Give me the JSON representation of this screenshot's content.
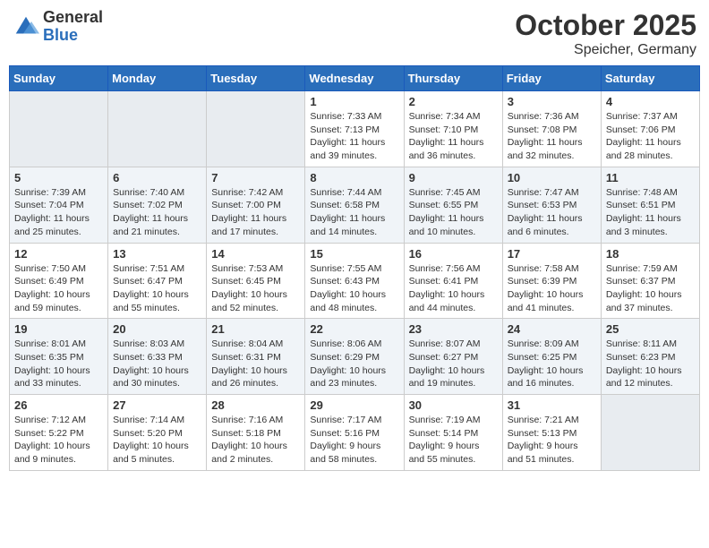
{
  "header": {
    "logo_general": "General",
    "logo_blue": "Blue",
    "month": "October 2025",
    "location": "Speicher, Germany"
  },
  "days_of_week": [
    "Sunday",
    "Monday",
    "Tuesday",
    "Wednesday",
    "Thursday",
    "Friday",
    "Saturday"
  ],
  "weeks": [
    [
      {
        "day": "",
        "info": "",
        "empty": true
      },
      {
        "day": "",
        "info": "",
        "empty": true
      },
      {
        "day": "",
        "info": "",
        "empty": true
      },
      {
        "day": "1",
        "info": "Sunrise: 7:33 AM\nSunset: 7:13 PM\nDaylight: 11 hours and 39 minutes."
      },
      {
        "day": "2",
        "info": "Sunrise: 7:34 AM\nSunset: 7:10 PM\nDaylight: 11 hours and 36 minutes."
      },
      {
        "day": "3",
        "info": "Sunrise: 7:36 AM\nSunset: 7:08 PM\nDaylight: 11 hours and 32 minutes."
      },
      {
        "day": "4",
        "info": "Sunrise: 7:37 AM\nSunset: 7:06 PM\nDaylight: 11 hours and 28 minutes."
      }
    ],
    [
      {
        "day": "5",
        "info": "Sunrise: 7:39 AM\nSunset: 7:04 PM\nDaylight: 11 hours and 25 minutes."
      },
      {
        "day": "6",
        "info": "Sunrise: 7:40 AM\nSunset: 7:02 PM\nDaylight: 11 hours and 21 minutes."
      },
      {
        "day": "7",
        "info": "Sunrise: 7:42 AM\nSunset: 7:00 PM\nDaylight: 11 hours and 17 minutes."
      },
      {
        "day": "8",
        "info": "Sunrise: 7:44 AM\nSunset: 6:58 PM\nDaylight: 11 hours and 14 minutes."
      },
      {
        "day": "9",
        "info": "Sunrise: 7:45 AM\nSunset: 6:55 PM\nDaylight: 11 hours and 10 minutes."
      },
      {
        "day": "10",
        "info": "Sunrise: 7:47 AM\nSunset: 6:53 PM\nDaylight: 11 hours and 6 minutes."
      },
      {
        "day": "11",
        "info": "Sunrise: 7:48 AM\nSunset: 6:51 PM\nDaylight: 11 hours and 3 minutes."
      }
    ],
    [
      {
        "day": "12",
        "info": "Sunrise: 7:50 AM\nSunset: 6:49 PM\nDaylight: 10 hours and 59 minutes."
      },
      {
        "day": "13",
        "info": "Sunrise: 7:51 AM\nSunset: 6:47 PM\nDaylight: 10 hours and 55 minutes."
      },
      {
        "day": "14",
        "info": "Sunrise: 7:53 AM\nSunset: 6:45 PM\nDaylight: 10 hours and 52 minutes."
      },
      {
        "day": "15",
        "info": "Sunrise: 7:55 AM\nSunset: 6:43 PM\nDaylight: 10 hours and 48 minutes."
      },
      {
        "day": "16",
        "info": "Sunrise: 7:56 AM\nSunset: 6:41 PM\nDaylight: 10 hours and 44 minutes."
      },
      {
        "day": "17",
        "info": "Sunrise: 7:58 AM\nSunset: 6:39 PM\nDaylight: 10 hours and 41 minutes."
      },
      {
        "day": "18",
        "info": "Sunrise: 7:59 AM\nSunset: 6:37 PM\nDaylight: 10 hours and 37 minutes."
      }
    ],
    [
      {
        "day": "19",
        "info": "Sunrise: 8:01 AM\nSunset: 6:35 PM\nDaylight: 10 hours and 33 minutes."
      },
      {
        "day": "20",
        "info": "Sunrise: 8:03 AM\nSunset: 6:33 PM\nDaylight: 10 hours and 30 minutes."
      },
      {
        "day": "21",
        "info": "Sunrise: 8:04 AM\nSunset: 6:31 PM\nDaylight: 10 hours and 26 minutes."
      },
      {
        "day": "22",
        "info": "Sunrise: 8:06 AM\nSunset: 6:29 PM\nDaylight: 10 hours and 23 minutes."
      },
      {
        "day": "23",
        "info": "Sunrise: 8:07 AM\nSunset: 6:27 PM\nDaylight: 10 hours and 19 minutes."
      },
      {
        "day": "24",
        "info": "Sunrise: 8:09 AM\nSunset: 6:25 PM\nDaylight: 10 hours and 16 minutes."
      },
      {
        "day": "25",
        "info": "Sunrise: 8:11 AM\nSunset: 6:23 PM\nDaylight: 10 hours and 12 minutes."
      }
    ],
    [
      {
        "day": "26",
        "info": "Sunrise: 7:12 AM\nSunset: 5:22 PM\nDaylight: 10 hours and 9 minutes."
      },
      {
        "day": "27",
        "info": "Sunrise: 7:14 AM\nSunset: 5:20 PM\nDaylight: 10 hours and 5 minutes."
      },
      {
        "day": "28",
        "info": "Sunrise: 7:16 AM\nSunset: 5:18 PM\nDaylight: 10 hours and 2 minutes."
      },
      {
        "day": "29",
        "info": "Sunrise: 7:17 AM\nSunset: 5:16 PM\nDaylight: 9 hours and 58 minutes."
      },
      {
        "day": "30",
        "info": "Sunrise: 7:19 AM\nSunset: 5:14 PM\nDaylight: 9 hours and 55 minutes."
      },
      {
        "day": "31",
        "info": "Sunrise: 7:21 AM\nSunset: 5:13 PM\nDaylight: 9 hours and 51 minutes."
      },
      {
        "day": "",
        "info": "",
        "empty": true
      }
    ]
  ]
}
